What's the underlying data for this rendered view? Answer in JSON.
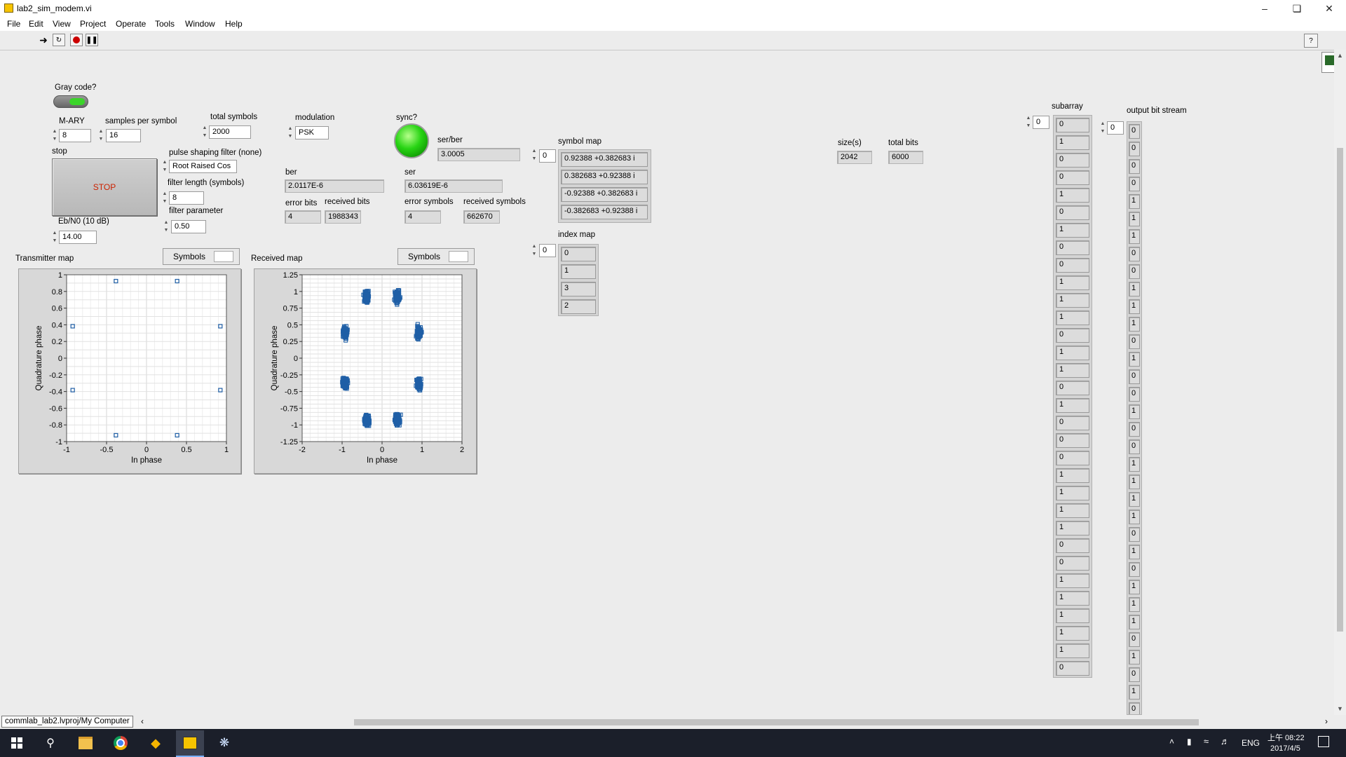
{
  "window": {
    "title": "lab2_sim_modem.vi"
  },
  "menu": [
    "File",
    "Edit",
    "View",
    "Project",
    "Operate",
    "Tools",
    "Window",
    "Help"
  ],
  "controls": {
    "gray_code": {
      "label": "Gray code?"
    },
    "mary": {
      "label": "M-ARY",
      "value": "8"
    },
    "samples_per_symbol": {
      "label": "samples per symbol",
      "value": "16"
    },
    "total_symbols": {
      "label": "total symbols",
      "value": "2000"
    },
    "modulation": {
      "label": "modulation",
      "value": "PSK"
    },
    "sync": {
      "label": "sync?"
    },
    "stop": {
      "label": "stop",
      "button": "STOP"
    },
    "pulse_filter": {
      "label": "pulse shaping filter (none)",
      "value": "Root Raised Cos"
    },
    "filter_length": {
      "label": "filter length (symbols)",
      "value": "8"
    },
    "filter_parameter": {
      "label": "filter parameter",
      "value": "0.50"
    },
    "ebn0": {
      "label": "Eb/N0 (10 dB)",
      "value": "14.00"
    },
    "ser_ber": {
      "label": "ser/ber",
      "value": "3.0005"
    },
    "ber": {
      "label": "ber",
      "value": "2.0117E-6"
    },
    "ser": {
      "label": "ser",
      "value": "6.03619E-6"
    },
    "error_bits": {
      "label": "error bits",
      "value": "4"
    },
    "received_bits": {
      "label": "received bits",
      "value": "1988343"
    },
    "error_symbols": {
      "label": "error symbols",
      "value": "4"
    },
    "received_symbols": {
      "label": "received symbols",
      "value": "662670"
    },
    "size": {
      "label": "size(s)",
      "value": "2042"
    },
    "total_bits": {
      "label": "total bits",
      "value": "6000"
    }
  },
  "symbol_map": {
    "label": "symbol map",
    "index": "0",
    "values": [
      "0.92388 +0.382683 i",
      "0.382683 +0.92388 i",
      "-0.92388 +0.382683 i",
      "-0.382683 +0.92388 i"
    ]
  },
  "index_map": {
    "label": "index map",
    "index": "0",
    "values": [
      "0",
      "1",
      "3",
      "2"
    ]
  },
  "subarray": {
    "label": "subarray",
    "index": "0",
    "values": [
      "0",
      "1",
      "0",
      "0",
      "1",
      "0",
      "1",
      "0",
      "0",
      "1",
      "1",
      "1",
      "0",
      "1",
      "1",
      "0",
      "1",
      "0",
      "0",
      "0",
      "1",
      "1",
      "1",
      "1",
      "0",
      "0",
      "1",
      "1",
      "1",
      "1",
      "1",
      "0"
    ]
  },
  "output_bit_stream": {
    "label": "output bit stream",
    "index": "0",
    "values": [
      "0",
      "0",
      "0",
      "0",
      "1",
      "1",
      "1",
      "0",
      "0",
      "1",
      "1",
      "1",
      "0",
      "1",
      "0",
      "0",
      "1",
      "0",
      "0",
      "1",
      "1",
      "1",
      "1",
      "0",
      "1",
      "0",
      "1",
      "1",
      "1",
      "0",
      "1",
      "0",
      "1",
      "0"
    ]
  },
  "graphs": {
    "transmitter": {
      "label": "Transmitter map",
      "legend": "Symbols"
    },
    "received": {
      "label": "Received map",
      "legend": "Symbols"
    }
  },
  "chart_data": [
    {
      "type": "scatter",
      "title": "Transmitter map",
      "xlabel": "In phase",
      "ylabel": "Quadrature phase",
      "xlim": [
        -1,
        1
      ],
      "ylim": [
        -1,
        1
      ],
      "xticks": [
        "-1",
        "-0.5",
        "0",
        "0.5",
        "1"
      ],
      "yticks": [
        "1",
        "0.8",
        "0.6",
        "0.4",
        "0.2",
        "0",
        "-0.2",
        "-0.4",
        "-0.6",
        "-0.8",
        "-1"
      ],
      "grid": true,
      "series": [
        {
          "name": "Symbols",
          "points": [
            [
              -0.383,
              0.924
            ],
            [
              0.383,
              0.924
            ],
            [
              -0.924,
              0.383
            ],
            [
              0.924,
              0.383
            ],
            [
              -0.924,
              -0.383
            ],
            [
              0.924,
              -0.383
            ],
            [
              -0.383,
              -0.924
            ],
            [
              0.383,
              -0.924
            ]
          ]
        }
      ]
    },
    {
      "type": "scatter",
      "title": "Received map",
      "xlabel": "In phase",
      "ylabel": "Quadrature phase",
      "xlim": [
        -2,
        2
      ],
      "ylim": [
        -1.25,
        1.25
      ],
      "xticks": [
        "-2",
        "-1",
        "0",
        "1",
        "2"
      ],
      "yticks": [
        "1.25",
        "1",
        "0.75",
        "0.5",
        "0.25",
        "0",
        "-0.25",
        "-0.5",
        "-0.75",
        "-1",
        "-1.25"
      ],
      "grid": true,
      "series": [
        {
          "name": "Symbols",
          "clusters": [
            [
              -0.383,
              0.924
            ],
            [
              0.383,
              0.924
            ],
            [
              -0.924,
              0.383
            ],
            [
              0.924,
              0.383
            ],
            [
              -0.924,
              -0.383
            ],
            [
              0.924,
              -0.383
            ],
            [
              -0.383,
              -0.924
            ],
            [
              0.383,
              -0.924
            ]
          ],
          "spread": 0.1
        }
      ]
    }
  ],
  "status": {
    "project": "commlab_lab2.lvproj/My Computer"
  },
  "taskbar": {
    "lang": "ENG",
    "time": "上午 08:22",
    "date": "2017/4/5"
  },
  "colors": {
    "accent": "#1f5fa6",
    "led_on": "#22cc11",
    "stop_text": "#cc2200"
  }
}
